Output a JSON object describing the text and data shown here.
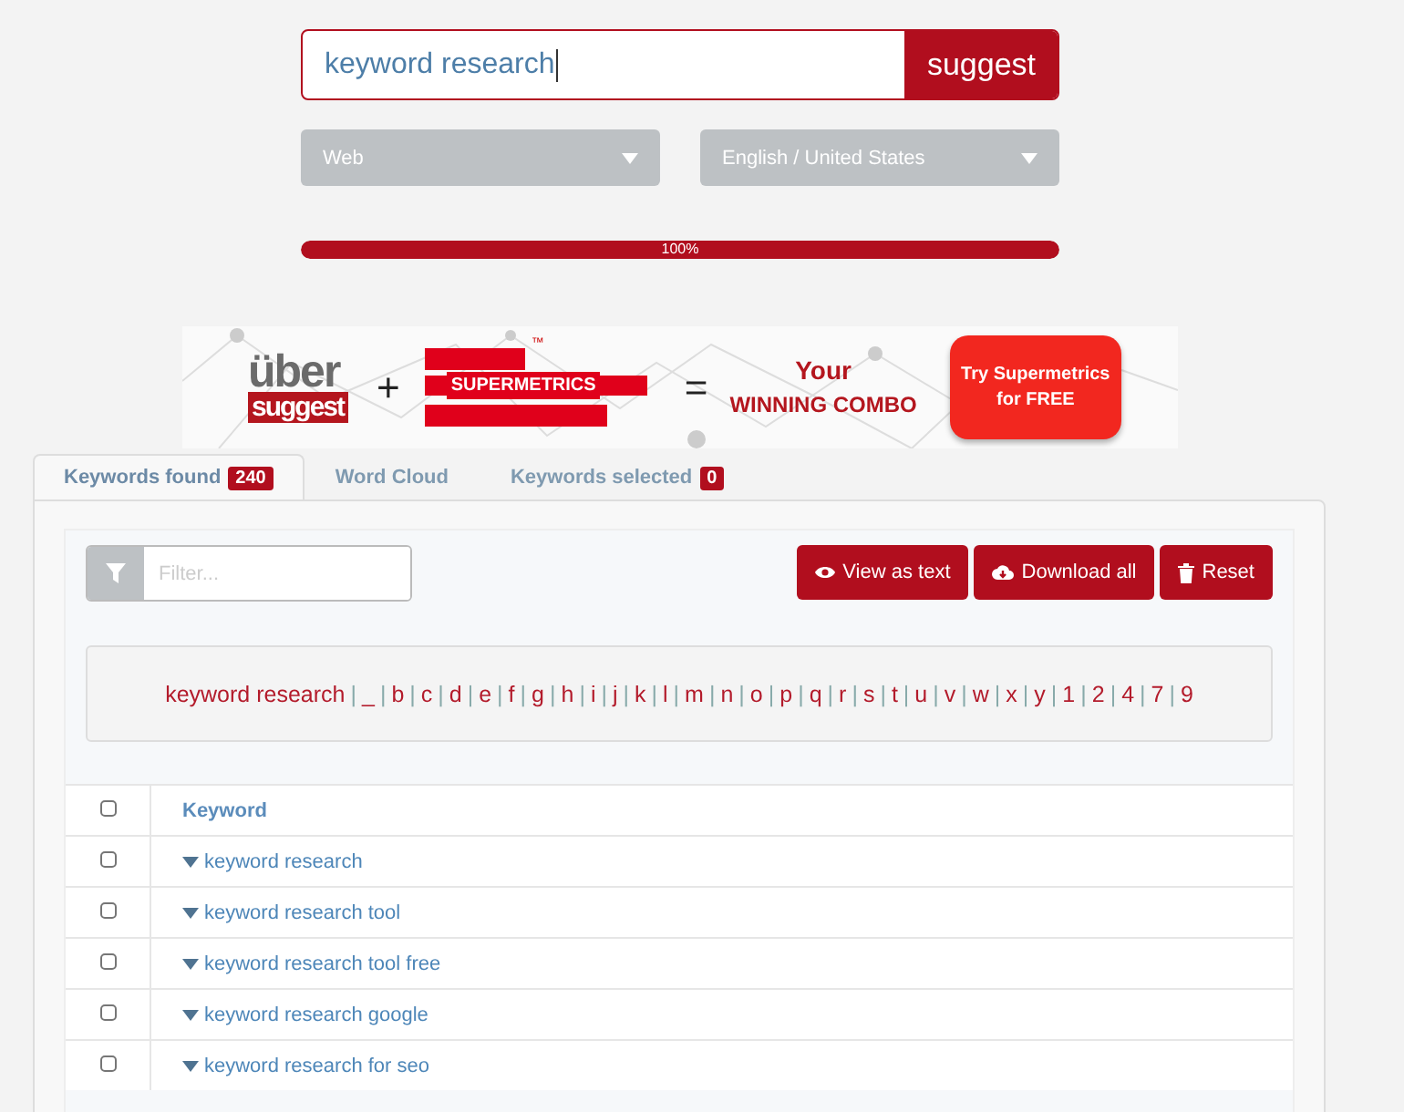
{
  "search": {
    "value": "keyword research",
    "button": "suggest"
  },
  "dropdowns": [
    {
      "value": "Web"
    },
    {
      "value": "English / United States"
    }
  ],
  "progress": {
    "level": 1,
    "label": "100%"
  },
  "banner": {
    "logo_top": "über",
    "logo_bottom": "suggest",
    "plus": "+",
    "brand": "SUPERMETRICS",
    "trademark": "™",
    "equals": "=",
    "tagline_1": "Your",
    "tagline_2": "WINNING COMBO",
    "cta": "Try Supermetrics for FREE"
  },
  "tabs": [
    {
      "label": "Keywords found",
      "badge": "240",
      "selected": true
    },
    {
      "label": "Word Cloud",
      "selected": false
    },
    {
      "label": "Keywords selected",
      "badge": "0",
      "selected": false
    }
  ],
  "filter": {
    "placeholder": "Filter..."
  },
  "actions": [
    {
      "kind": "view",
      "label": "View as text"
    },
    {
      "kind": "download",
      "label": "Download all"
    },
    {
      "kind": "reset",
      "label": "Reset"
    }
  ],
  "letters": [
    {
      "kind": "link",
      "text": "keyword research"
    },
    {
      "kind": "separator",
      "text": "|"
    },
    {
      "kind": "link",
      "text": "_"
    },
    {
      "kind": "separator",
      "text": "|"
    },
    {
      "kind": "link",
      "text": "b"
    },
    {
      "kind": "separator",
      "text": "|"
    },
    {
      "kind": "link",
      "text": "c"
    },
    {
      "kind": "separator",
      "text": "|"
    },
    {
      "kind": "link",
      "text": "d"
    },
    {
      "kind": "separator",
      "text": "|"
    },
    {
      "kind": "link",
      "text": "e"
    },
    {
      "kind": "separator",
      "text": "|"
    },
    {
      "kind": "link",
      "text": "f"
    },
    {
      "kind": "separator",
      "text": "|"
    },
    {
      "kind": "link",
      "text": "g"
    },
    {
      "kind": "separator",
      "text": "|"
    },
    {
      "kind": "link",
      "text": "h"
    },
    {
      "kind": "separator",
      "text": "|"
    },
    {
      "kind": "link",
      "text": "i"
    },
    {
      "kind": "separator",
      "text": "|"
    },
    {
      "kind": "link",
      "text": "j"
    },
    {
      "kind": "separator",
      "text": "|"
    },
    {
      "kind": "link",
      "text": "k"
    },
    {
      "kind": "separator",
      "text": "|"
    },
    {
      "kind": "link",
      "text": "l"
    },
    {
      "kind": "separator",
      "text": "|"
    },
    {
      "kind": "link",
      "text": "m"
    },
    {
      "kind": "separator",
      "text": "|"
    },
    {
      "kind": "link",
      "text": "n"
    },
    {
      "kind": "separator",
      "text": "|"
    },
    {
      "kind": "link",
      "text": "o"
    },
    {
      "kind": "separator",
      "text": "|"
    },
    {
      "kind": "link",
      "text": "p"
    },
    {
      "kind": "separator",
      "text": "|"
    },
    {
      "kind": "link",
      "text": "q"
    },
    {
      "kind": "separator",
      "text": "|"
    },
    {
      "kind": "link",
      "text": "r"
    },
    {
      "kind": "separator",
      "text": "|"
    },
    {
      "kind": "link",
      "text": "s"
    },
    {
      "kind": "separator",
      "text": "|"
    },
    {
      "kind": "link",
      "text": "t"
    },
    {
      "kind": "separator",
      "text": "|"
    },
    {
      "kind": "link",
      "text": "u"
    },
    {
      "kind": "separator",
      "text": "|"
    },
    {
      "kind": "link",
      "text": "v"
    },
    {
      "kind": "separator",
      "text": "|"
    },
    {
      "kind": "link",
      "text": "w"
    },
    {
      "kind": "separator",
      "text": "|"
    },
    {
      "kind": "link",
      "text": "x"
    },
    {
      "kind": "separator",
      "text": "|"
    },
    {
      "kind": "link",
      "text": "y"
    },
    {
      "kind": "separator",
      "text": "|"
    },
    {
      "kind": "link",
      "text": "1"
    },
    {
      "kind": "separator",
      "text": "|"
    },
    {
      "kind": "link",
      "text": "2"
    },
    {
      "kind": "separator",
      "text": "|"
    },
    {
      "kind": "link",
      "text": "4"
    },
    {
      "kind": "separator",
      "text": "|"
    },
    {
      "kind": "link",
      "text": "7"
    },
    {
      "kind": "separator",
      "text": "|"
    },
    {
      "kind": "link",
      "text": "9"
    }
  ],
  "table": {
    "header": {
      "label": "Keyword",
      "checked": false
    },
    "rows": [
      {
        "keyword": "keyword research",
        "checked": false
      },
      {
        "keyword": "keyword research tool",
        "checked": false
      },
      {
        "keyword": "keyword research tool free",
        "checked": false
      },
      {
        "keyword": "keyword research google",
        "checked": false
      },
      {
        "keyword": "keyword research for seo",
        "checked": false
      }
    ]
  }
}
